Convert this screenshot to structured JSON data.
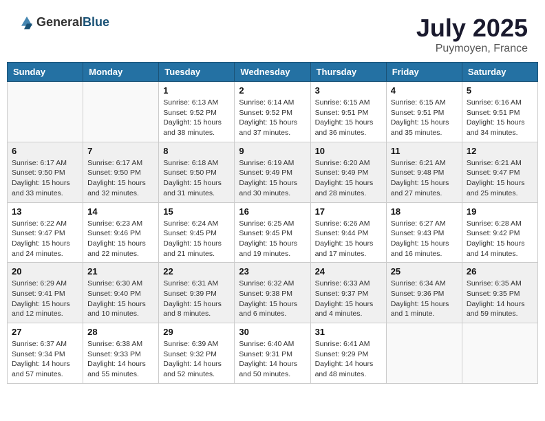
{
  "logo": {
    "text1": "General",
    "text2": "Blue"
  },
  "title": {
    "month_year": "July 2025",
    "location": "Puymoyen, France"
  },
  "headers": [
    "Sunday",
    "Monday",
    "Tuesday",
    "Wednesday",
    "Thursday",
    "Friday",
    "Saturday"
  ],
  "weeks": [
    [
      {
        "day": "",
        "sunrise": "",
        "sunset": "",
        "daylight": ""
      },
      {
        "day": "",
        "sunrise": "",
        "sunset": "",
        "daylight": ""
      },
      {
        "day": "1",
        "sunrise": "Sunrise: 6:13 AM",
        "sunset": "Sunset: 9:52 PM",
        "daylight": "Daylight: 15 hours and 38 minutes."
      },
      {
        "day": "2",
        "sunrise": "Sunrise: 6:14 AM",
        "sunset": "Sunset: 9:52 PM",
        "daylight": "Daylight: 15 hours and 37 minutes."
      },
      {
        "day": "3",
        "sunrise": "Sunrise: 6:15 AM",
        "sunset": "Sunset: 9:51 PM",
        "daylight": "Daylight: 15 hours and 36 minutes."
      },
      {
        "day": "4",
        "sunrise": "Sunrise: 6:15 AM",
        "sunset": "Sunset: 9:51 PM",
        "daylight": "Daylight: 15 hours and 35 minutes."
      },
      {
        "day": "5",
        "sunrise": "Sunrise: 6:16 AM",
        "sunset": "Sunset: 9:51 PM",
        "daylight": "Daylight: 15 hours and 34 minutes."
      }
    ],
    [
      {
        "day": "6",
        "sunrise": "Sunrise: 6:17 AM",
        "sunset": "Sunset: 9:50 PM",
        "daylight": "Daylight: 15 hours and 33 minutes."
      },
      {
        "day": "7",
        "sunrise": "Sunrise: 6:17 AM",
        "sunset": "Sunset: 9:50 PM",
        "daylight": "Daylight: 15 hours and 32 minutes."
      },
      {
        "day": "8",
        "sunrise": "Sunrise: 6:18 AM",
        "sunset": "Sunset: 9:50 PM",
        "daylight": "Daylight: 15 hours and 31 minutes."
      },
      {
        "day": "9",
        "sunrise": "Sunrise: 6:19 AM",
        "sunset": "Sunset: 9:49 PM",
        "daylight": "Daylight: 15 hours and 30 minutes."
      },
      {
        "day": "10",
        "sunrise": "Sunrise: 6:20 AM",
        "sunset": "Sunset: 9:49 PM",
        "daylight": "Daylight: 15 hours and 28 minutes."
      },
      {
        "day": "11",
        "sunrise": "Sunrise: 6:21 AM",
        "sunset": "Sunset: 9:48 PM",
        "daylight": "Daylight: 15 hours and 27 minutes."
      },
      {
        "day": "12",
        "sunrise": "Sunrise: 6:21 AM",
        "sunset": "Sunset: 9:47 PM",
        "daylight": "Daylight: 15 hours and 25 minutes."
      }
    ],
    [
      {
        "day": "13",
        "sunrise": "Sunrise: 6:22 AM",
        "sunset": "Sunset: 9:47 PM",
        "daylight": "Daylight: 15 hours and 24 minutes."
      },
      {
        "day": "14",
        "sunrise": "Sunrise: 6:23 AM",
        "sunset": "Sunset: 9:46 PM",
        "daylight": "Daylight: 15 hours and 22 minutes."
      },
      {
        "day": "15",
        "sunrise": "Sunrise: 6:24 AM",
        "sunset": "Sunset: 9:45 PM",
        "daylight": "Daylight: 15 hours and 21 minutes."
      },
      {
        "day": "16",
        "sunrise": "Sunrise: 6:25 AM",
        "sunset": "Sunset: 9:45 PM",
        "daylight": "Daylight: 15 hours and 19 minutes."
      },
      {
        "day": "17",
        "sunrise": "Sunrise: 6:26 AM",
        "sunset": "Sunset: 9:44 PM",
        "daylight": "Daylight: 15 hours and 17 minutes."
      },
      {
        "day": "18",
        "sunrise": "Sunrise: 6:27 AM",
        "sunset": "Sunset: 9:43 PM",
        "daylight": "Daylight: 15 hours and 16 minutes."
      },
      {
        "day": "19",
        "sunrise": "Sunrise: 6:28 AM",
        "sunset": "Sunset: 9:42 PM",
        "daylight": "Daylight: 15 hours and 14 minutes."
      }
    ],
    [
      {
        "day": "20",
        "sunrise": "Sunrise: 6:29 AM",
        "sunset": "Sunset: 9:41 PM",
        "daylight": "Daylight: 15 hours and 12 minutes."
      },
      {
        "day": "21",
        "sunrise": "Sunrise: 6:30 AM",
        "sunset": "Sunset: 9:40 PM",
        "daylight": "Daylight: 15 hours and 10 minutes."
      },
      {
        "day": "22",
        "sunrise": "Sunrise: 6:31 AM",
        "sunset": "Sunset: 9:39 PM",
        "daylight": "Daylight: 15 hours and 8 minutes."
      },
      {
        "day": "23",
        "sunrise": "Sunrise: 6:32 AM",
        "sunset": "Sunset: 9:38 PM",
        "daylight": "Daylight: 15 hours and 6 minutes."
      },
      {
        "day": "24",
        "sunrise": "Sunrise: 6:33 AM",
        "sunset": "Sunset: 9:37 PM",
        "daylight": "Daylight: 15 hours and 4 minutes."
      },
      {
        "day": "25",
        "sunrise": "Sunrise: 6:34 AM",
        "sunset": "Sunset: 9:36 PM",
        "daylight": "Daylight: 15 hours and 1 minute."
      },
      {
        "day": "26",
        "sunrise": "Sunrise: 6:35 AM",
        "sunset": "Sunset: 9:35 PM",
        "daylight": "Daylight: 14 hours and 59 minutes."
      }
    ],
    [
      {
        "day": "27",
        "sunrise": "Sunrise: 6:37 AM",
        "sunset": "Sunset: 9:34 PM",
        "daylight": "Daylight: 14 hours and 57 minutes."
      },
      {
        "day": "28",
        "sunrise": "Sunrise: 6:38 AM",
        "sunset": "Sunset: 9:33 PM",
        "daylight": "Daylight: 14 hours and 55 minutes."
      },
      {
        "day": "29",
        "sunrise": "Sunrise: 6:39 AM",
        "sunset": "Sunset: 9:32 PM",
        "daylight": "Daylight: 14 hours and 52 minutes."
      },
      {
        "day": "30",
        "sunrise": "Sunrise: 6:40 AM",
        "sunset": "Sunset: 9:31 PM",
        "daylight": "Daylight: 14 hours and 50 minutes."
      },
      {
        "day": "31",
        "sunrise": "Sunrise: 6:41 AM",
        "sunset": "Sunset: 9:29 PM",
        "daylight": "Daylight: 14 hours and 48 minutes."
      },
      {
        "day": "",
        "sunrise": "",
        "sunset": "",
        "daylight": ""
      },
      {
        "day": "",
        "sunrise": "",
        "sunset": "",
        "daylight": ""
      }
    ]
  ]
}
